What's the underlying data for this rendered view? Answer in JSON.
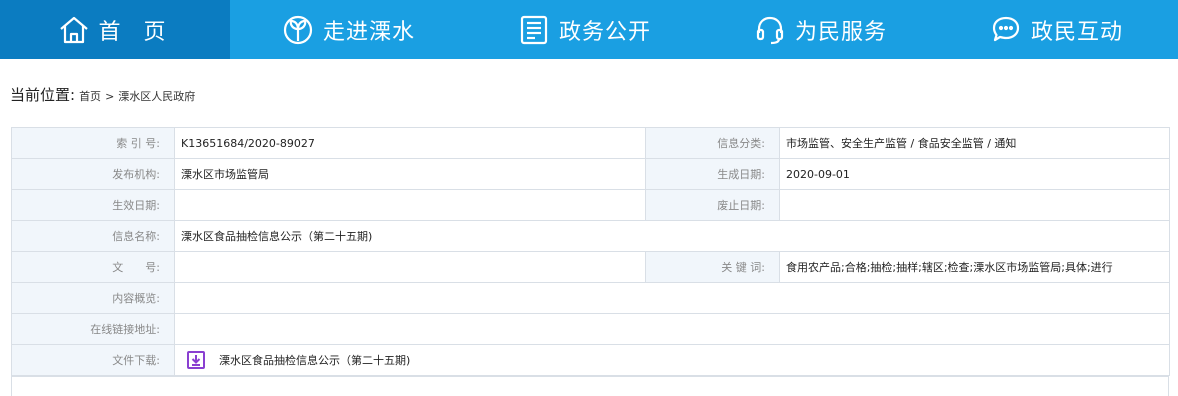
{
  "nav": {
    "items": [
      {
        "label": "首 页",
        "icon": "home-icon"
      },
      {
        "label": "走进溧水",
        "icon": "leaf-icon"
      },
      {
        "label": "政务公开",
        "icon": "document-icon"
      },
      {
        "label": "为民服务",
        "icon": "headset-icon"
      },
      {
        "label": "政民互动",
        "icon": "chat-icon"
      }
    ]
  },
  "breadcrumb": {
    "label": "当前位置:",
    "home": "首页",
    "separator": ">",
    "current": "溧水区人民政府"
  },
  "info": {
    "index_label": "索 引 号:",
    "index_value": "K13651684/2020-89027",
    "category_label": "信息分类:",
    "category_value": "市场监管、安全生产监管 / 食品安全监管 / 通知",
    "publisher_label": "发布机构:",
    "publisher_value": "溧水区市场监管局",
    "created_label": "生成日期:",
    "created_value": "2020-09-01",
    "effective_label": "生效日期:",
    "effective_value": "",
    "abolish_label": "废止日期:",
    "abolish_value": "",
    "name_label": "信息名称:",
    "name_value": "溧水区食品抽检信息公示（第二十五期)",
    "docno_label": "文　　号:",
    "docno_value": "",
    "keywords_label": "关 键 词:",
    "keywords_value": "食用农产品;合格;抽检;抽样;辖区;检查;溧水区市场监管局;具体;进行",
    "summary_label": "内容概览:",
    "summary_value": "",
    "link_label": "在线链接地址:",
    "link_value": "",
    "download_label": "文件下载:",
    "download_value": "溧水区食品抽检信息公示（第二十五期)"
  },
  "colors": {
    "nav_bg": "#1a9fe2",
    "nav_active_bg": "#0b7cc1",
    "label_bg": "#f1f6fb",
    "border": "#d9dfe6",
    "download_icon": "#8a3fd1"
  }
}
